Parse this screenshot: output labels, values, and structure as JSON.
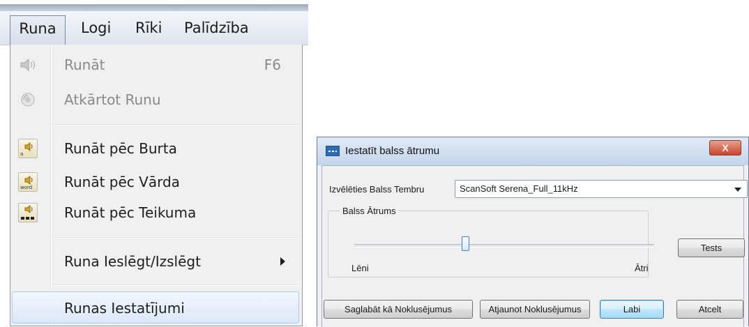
{
  "menu_bar": {
    "items": [
      "Runa",
      "Logi",
      "Rīki",
      "Palīdzība"
    ]
  },
  "runa_menu": {
    "speak": {
      "label": "Runāt",
      "shortcut": "F6",
      "icon": "speaker-icon",
      "enabled": false
    },
    "repeat": {
      "label": "Atkārtot Runu",
      "icon": "repeat-icon",
      "enabled": false
    },
    "by_letter": {
      "label": "Runāt pēc Burta",
      "icon": "speaker-letter-icon"
    },
    "by_word": {
      "label": "Runāt pēc Vārda",
      "icon": "speaker-word-icon"
    },
    "by_sentence": {
      "label": "Runāt pēc Teikuma",
      "icon": "speaker-sentence-icon"
    },
    "toggle": {
      "label": "Runa Ieslēgt/Izslēgt",
      "has_submenu": true
    },
    "settings": {
      "label": "Runas Iestatījumi",
      "highlighted": true
    }
  },
  "dialog": {
    "title": "Iestatīt balss ātrumu",
    "close_label": "X",
    "timbre_label": "Izvēlēties Balss Tembru",
    "timbre_value": "ScanSoft Serena_Full_11kHz",
    "speed_group_label": "Balss Ātrums",
    "slow_label": "Lēni",
    "fast_label": "Ātri",
    "slider_value_fraction": 0.37,
    "buttons": {
      "tests": "Tests",
      "save_default": "Saglabāt kā Noklusējumus",
      "restore_default": "Atjaunot Noklusējumus",
      "ok": "Labi",
      "cancel": "Atcelt"
    }
  },
  "colors": {
    "menu_highlight": "#dbe8f8",
    "dialog_titlebar": "#c3d5ea",
    "close_button": "#c9452b",
    "default_button": "#bee6fd"
  }
}
